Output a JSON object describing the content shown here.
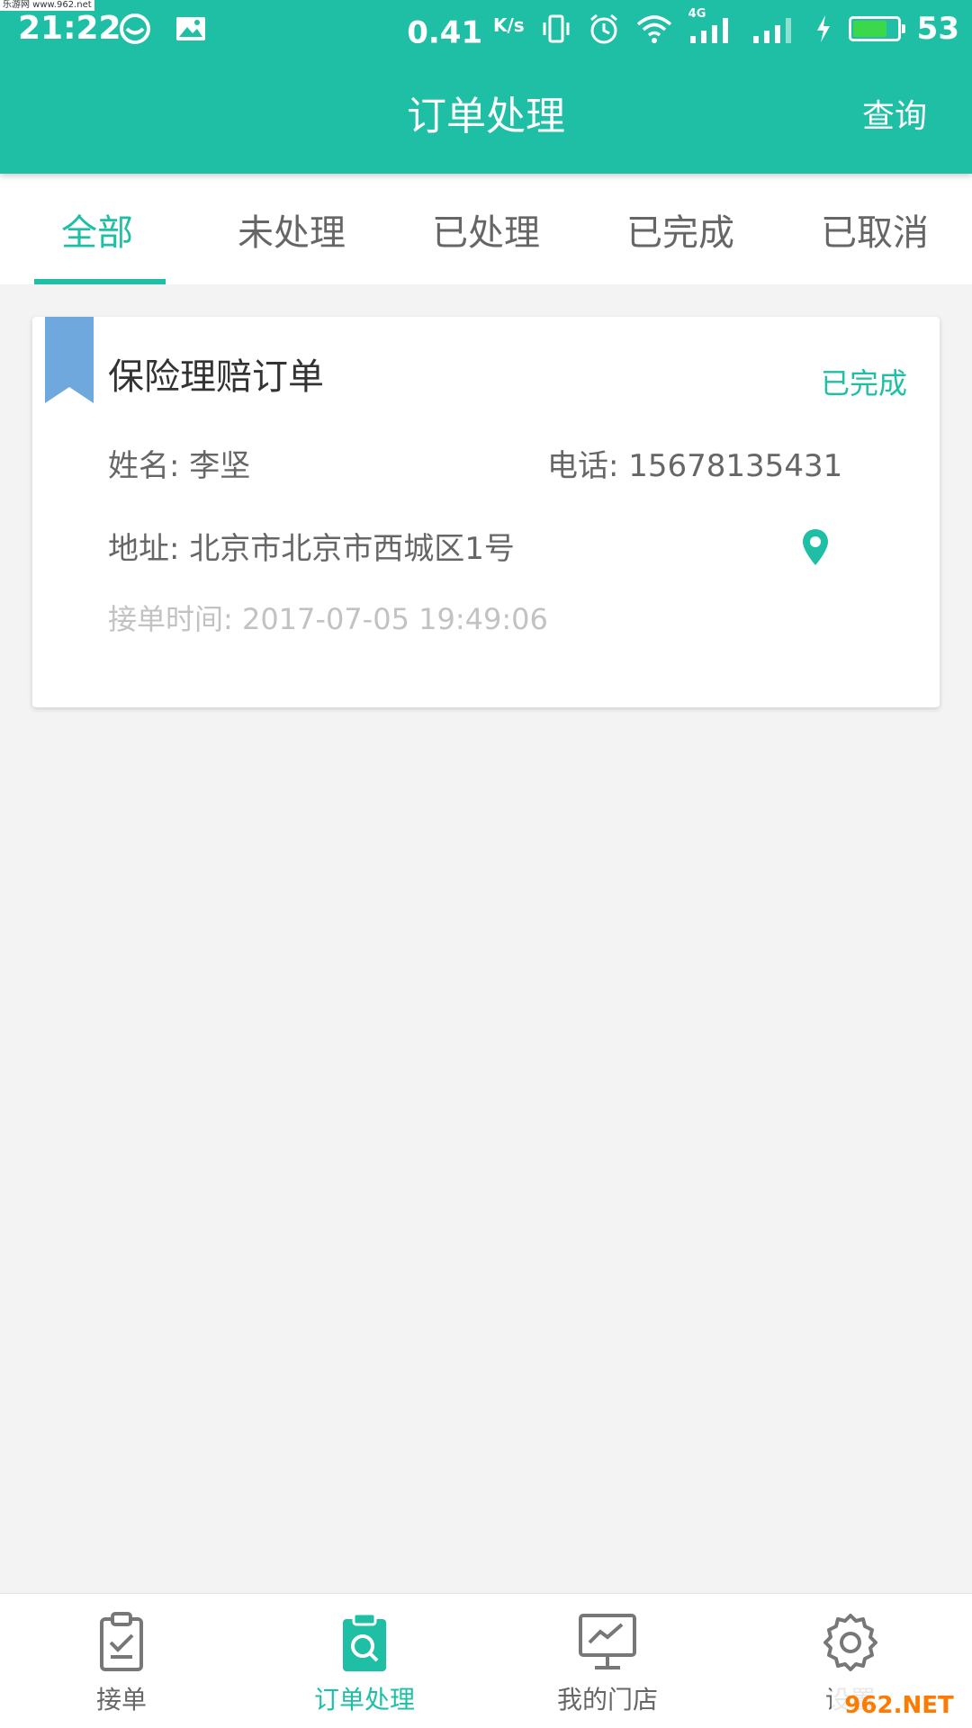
{
  "watermark_top": "乐游网 www.962.net",
  "status_bar": {
    "time": "21:22",
    "speed": "0.41",
    "speed_unit": "K/s",
    "network": "4G",
    "battery": "53",
    "battery_level_pct": 80,
    "icons": [
      "face-icon",
      "image-icon",
      "vibrate-icon",
      "alarm-icon",
      "wifi-icon",
      "signal-icon",
      "signal-icon",
      "charging-icon"
    ]
  },
  "header": {
    "title": "订单处理",
    "action": "查询",
    "color": "#1fbfa6"
  },
  "tabs": [
    {
      "label": "全部",
      "active": true
    },
    {
      "label": "未处理",
      "active": false
    },
    {
      "label": "已处理",
      "active": false
    },
    {
      "label": "已完成",
      "active": false
    },
    {
      "label": "已取消",
      "active": false
    }
  ],
  "order": {
    "title": "保险理赔订单",
    "status": "已完成",
    "name": "姓名: 李坚",
    "phone": "电话: 15678135431",
    "address": "地址: 北京市北京市西城区1号",
    "time": "接单时间: 2017-07-05 19:49:06",
    "bookmark_color": "#6fa8dc"
  },
  "bottom_nav": [
    {
      "label": "接单",
      "icon": "clipboard-check-icon",
      "active": false
    },
    {
      "label": "订单处理",
      "icon": "clipboard-search-icon",
      "active": true
    },
    {
      "label": "我的门店",
      "icon": "monitor-chart-icon",
      "active": false
    },
    {
      "label": "设置",
      "icon": "gear-icon",
      "active": false
    }
  ],
  "watermark_bottom": "962.NET"
}
